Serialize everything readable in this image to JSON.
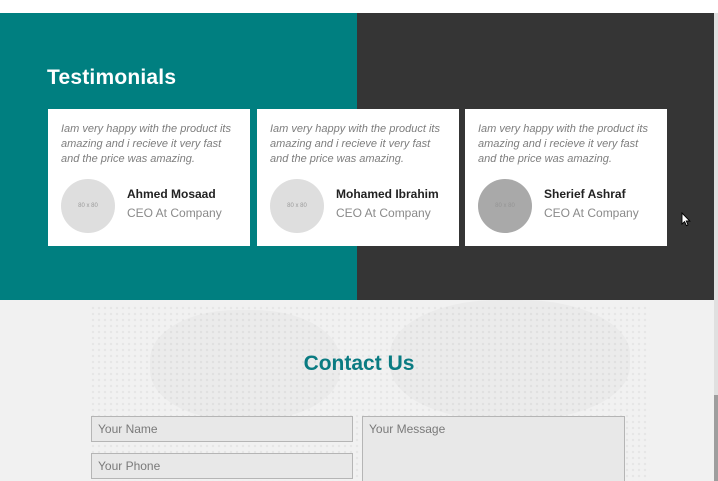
{
  "testimonials": {
    "title": "Testimonials",
    "cards": [
      {
        "quote": "Iam very happy with the product its amazing and i recieve it very fast and the price was amazing.",
        "avatar_text": "80 x 80",
        "name": "Ahmed Mosaad",
        "role": "CEO At Company"
      },
      {
        "quote": "Iam very happy with the product its amazing and i recieve it very fast and the price was amazing.",
        "avatar_text": "80 x 80",
        "name": "Mohamed Ibrahim",
        "role": "CEO At Company"
      },
      {
        "quote": "Iam very happy with the product its amazing and i recieve it very fast and the price was amazing.",
        "avatar_text": "80 x 80",
        "name": "Sherief Ashraf",
        "role": "CEO At Company"
      }
    ]
  },
  "contact": {
    "title": "Contact Us",
    "name_placeholder": "Your Name",
    "phone_placeholder": "Your Phone",
    "message_placeholder": "Your Message"
  },
  "colors": {
    "teal": "#007f80",
    "dark": "#353535",
    "heading_teal": "#0a7b82"
  },
  "icons": {
    "cursor": "mouse-pointer-icon"
  }
}
